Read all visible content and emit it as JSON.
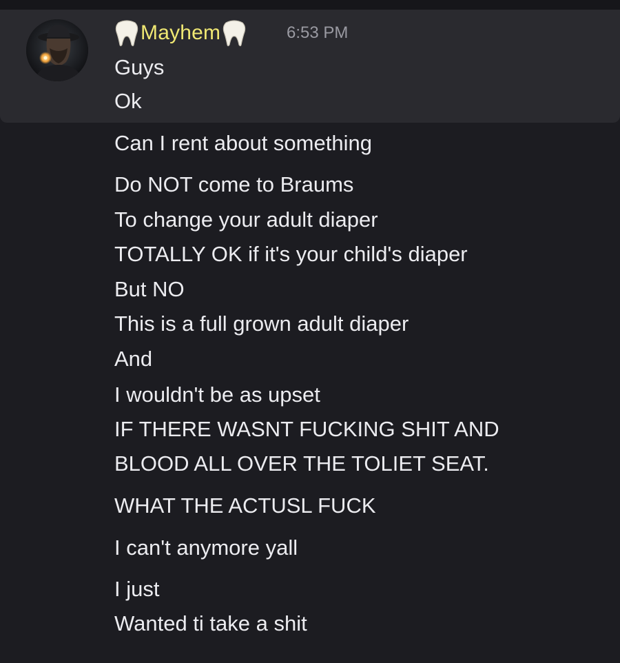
{
  "message": {
    "author": "Mayhem",
    "author_color": "#f0e873",
    "author_decoration_icons": [
      "tooth-icon",
      "tooth-icon"
    ],
    "timestamp": "6:53 PM",
    "lines": [
      "Guys",
      "Ok",
      "Can I rent about something",
      "Do NOT come to Braums",
      "To change your adult diaper",
      "TOTALLY OK if it's your child's diaper",
      "But NO",
      "This is a full grown adult diaper",
      "And",
      "I wouldn't be as upset",
      "IF THERE WASNT FUCKING SHIT AND",
      "BLOOD ALL OVER THE TOLIET SEAT.",
      "WHAT THE ACTUSL FUCK",
      "I can't anymore yall",
      "I just",
      "Wanted ti take a shit"
    ]
  }
}
